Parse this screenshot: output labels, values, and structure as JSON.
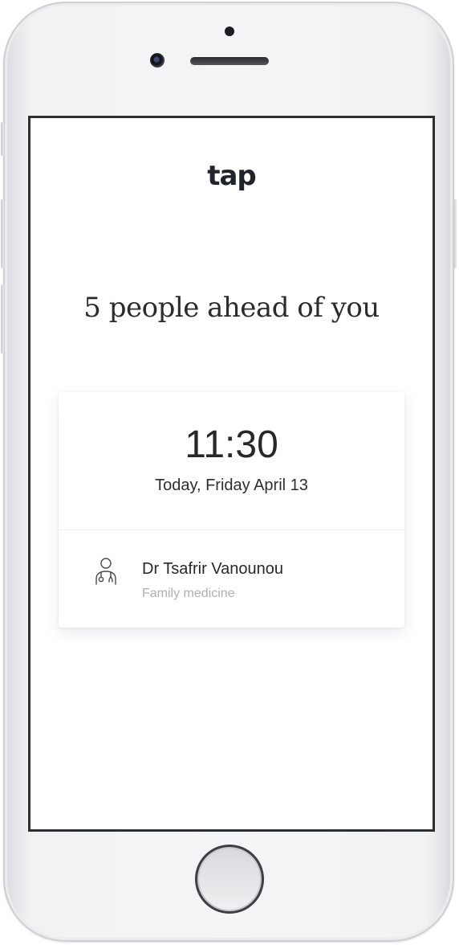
{
  "app": {
    "logo_text": "tap"
  },
  "queue": {
    "headline": "5 people ahead of you",
    "people_ahead": 5
  },
  "appointment": {
    "time": "11:30",
    "date": "Today, Friday April 13"
  },
  "doctor": {
    "icon": "doctor-icon",
    "name": "Dr Tsafrir Vanounou",
    "specialty": "Family medicine"
  },
  "colors": {
    "text_primary": "#26272c",
    "text_secondary": "#aeb0b6",
    "background": "#ffffff"
  }
}
